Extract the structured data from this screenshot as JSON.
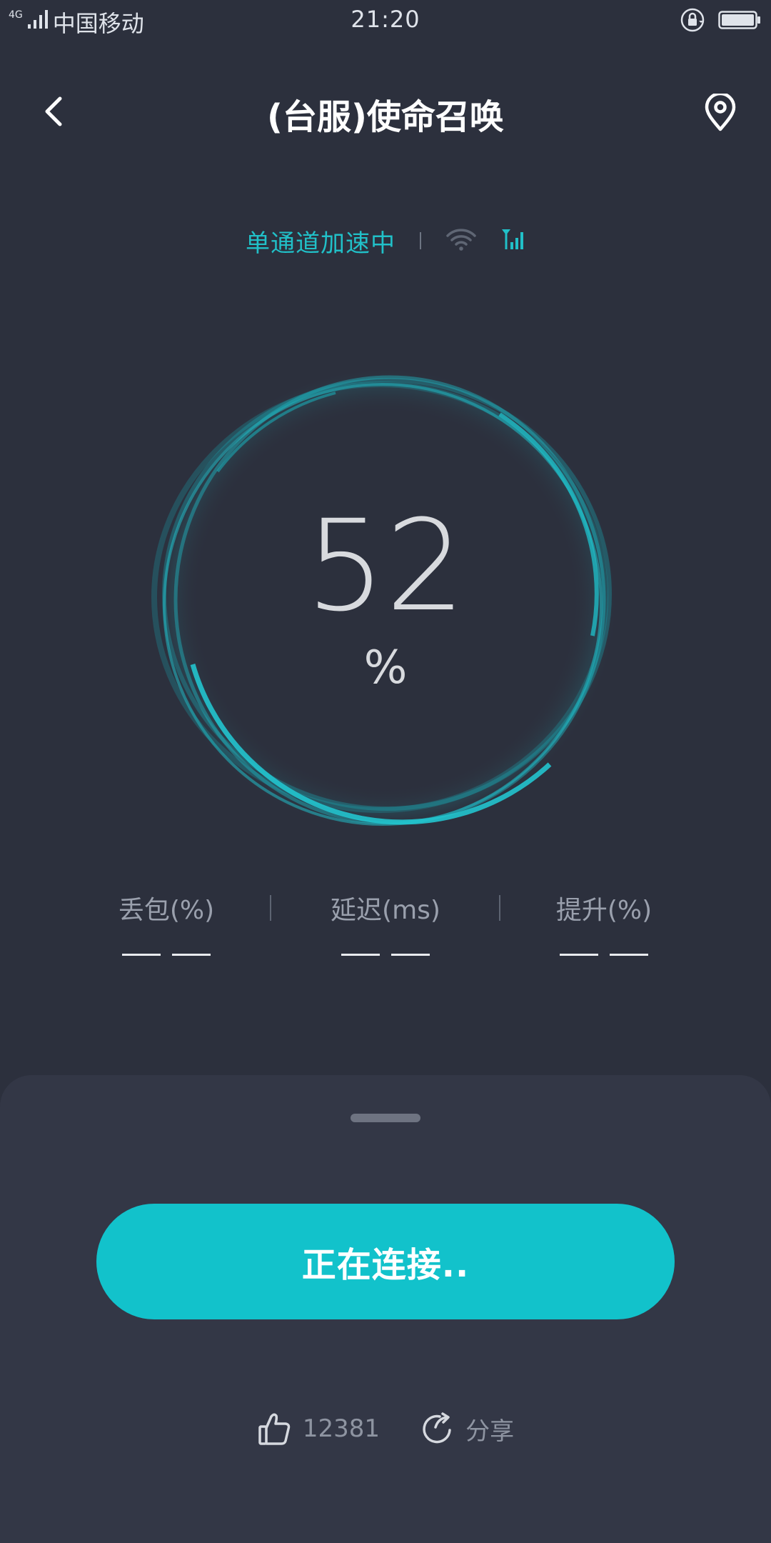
{
  "status_bar": {
    "network_type": "4G",
    "carrier": "中国移动",
    "time": "21:20"
  },
  "header": {
    "title": "(台服)使命召唤",
    "back_icon": "chevron-left-icon",
    "location_icon": "location-pin-icon"
  },
  "acceleration": {
    "status_text": "单通道加速中",
    "wifi_icon": "wifi-icon",
    "cellular_icon": "cellular-signal-icon",
    "accent_color": "#21c0c8"
  },
  "progress": {
    "value": "52",
    "unit": "%"
  },
  "stats": [
    {
      "label": "丢包(%)",
      "value": "— —"
    },
    {
      "label": "延迟(ms)",
      "value": "— —"
    },
    {
      "label": "提升(%)",
      "value": "— —"
    }
  ],
  "sheet": {
    "connect_button": "正在连接..",
    "like_count": "12381",
    "share_label": "分享",
    "button_color": "#12c2cb"
  },
  "colors": {
    "background": "#2c303d",
    "sheet": "#333746"
  }
}
